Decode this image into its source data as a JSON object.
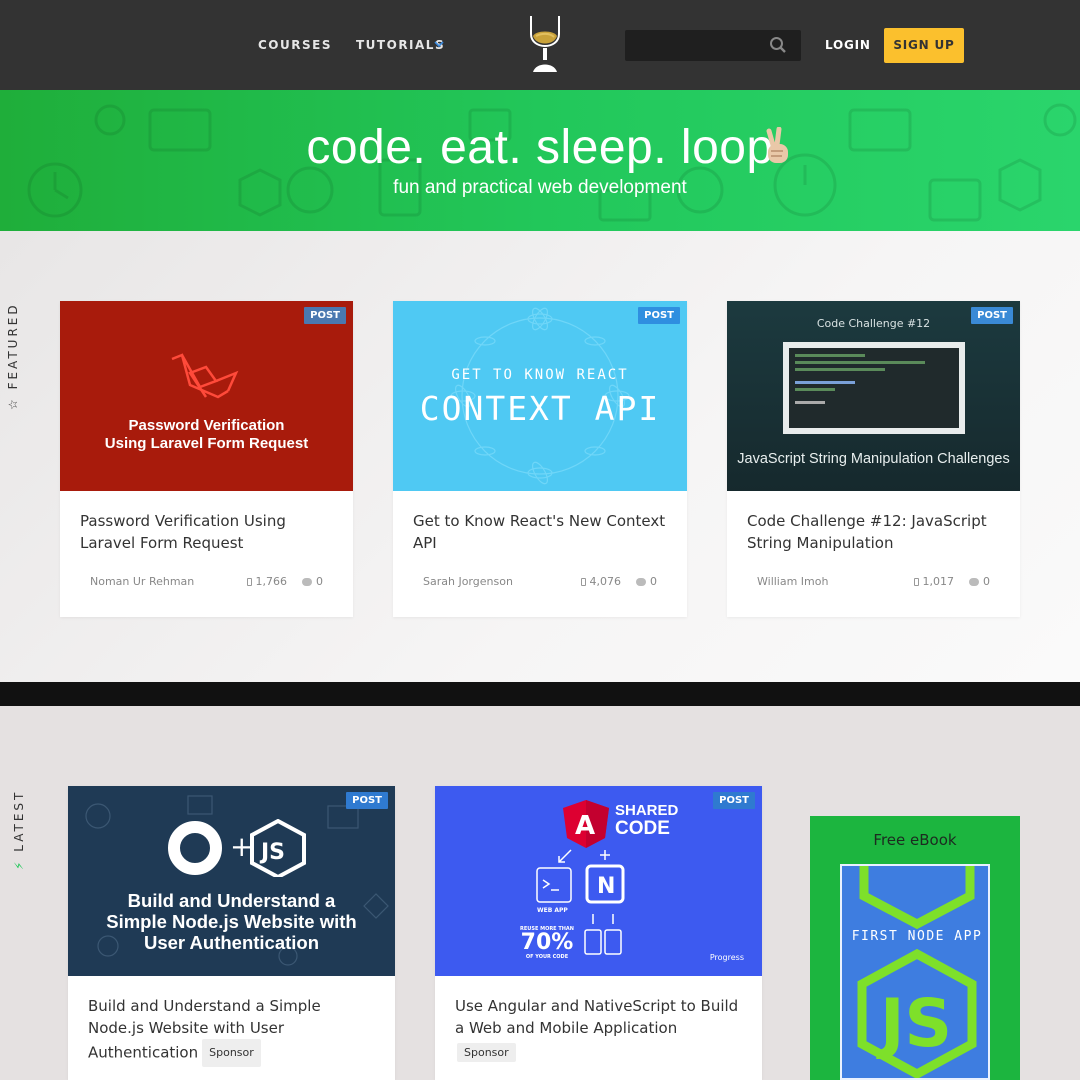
{
  "header": {
    "nav": [
      "COURSES",
      "TUTORIALS"
    ],
    "search_placeholder": "",
    "login": "LOGIN",
    "signup": "SIGN UP",
    "logo_icon": "whisky-glass-logo"
  },
  "hero": {
    "title": "code. eat. sleep. loop",
    "emoji_icon": "peace-hand-icon",
    "subtitle": "fun and practical web development"
  },
  "featured": {
    "label": "FEATURED",
    "cards": [
      {
        "badge": "POST",
        "image_text": [
          "Password Verification",
          "Using Laravel Form Request"
        ],
        "title": "Password Verification Using Laravel Form Request",
        "author": "Noman Ur Rehman",
        "views": "1,766",
        "comments": "0"
      },
      {
        "badge": "POST",
        "image_text": [
          "GET TO KNOW REACT",
          "CONTEXT API"
        ],
        "title": "Get to Know React's New Context API",
        "author": "Sarah Jorgenson",
        "views": "4,076",
        "comments": "0"
      },
      {
        "badge": "POST",
        "image_text": [
          "Code Challenge #12",
          "JavaScript String Manipulation Challenges"
        ],
        "title": "Code Challenge #12: JavaScript String Manipulation",
        "author": "William Imoh",
        "views": "1,017",
        "comments": "0"
      }
    ]
  },
  "latest": {
    "label": "LATEST",
    "cards": [
      {
        "badge": "POST",
        "image_text": [
          "Build and Understand a",
          "Simple Node.js Website with",
          "User Authentication"
        ],
        "title": "Build and Understand a Simple Node.js Website with User Authentication",
        "tag": "Sponsor"
      },
      {
        "badge": "POST",
        "image_text": [
          "SHARED",
          "CODE",
          "WEB APP",
          "REUSE MORE THAN",
          "70%",
          "OF YOUR CODE",
          "Progress"
        ],
        "title": "Use Angular and NativeScript to Build a Web and Mobile Application",
        "tag": "Sponsor"
      }
    ],
    "ebook": {
      "title": "Free eBook",
      "cover_text": "FIRST NODE APP"
    }
  },
  "colors": {
    "header_bg": "#333333",
    "hero_green": "#22c75a",
    "signup_yellow": "#fbc02d",
    "badge_blue": "#3b7ed9"
  }
}
